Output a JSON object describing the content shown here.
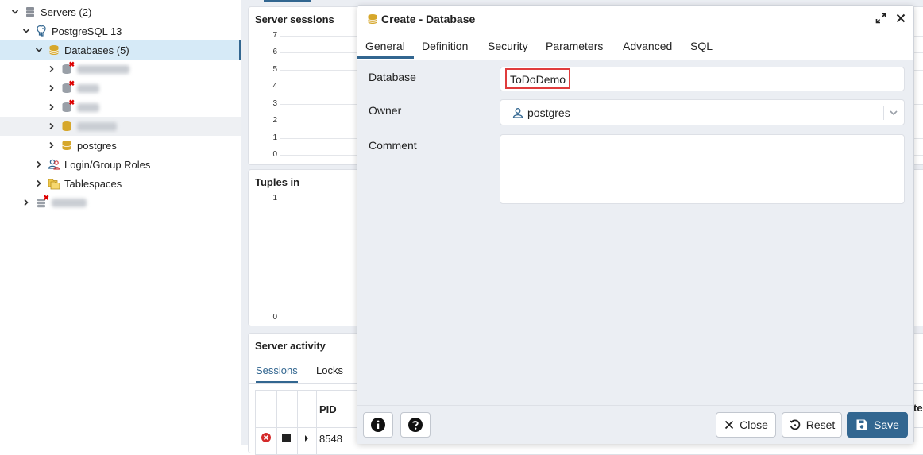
{
  "tree": {
    "servers_label": "Servers (2)",
    "pg_label": "PostgreSQL 13",
    "databases_label": "Databases (5)",
    "postgres_label": "postgres",
    "login_roles_label": "Login/Group Roles",
    "tablespaces_label": "Tablespaces"
  },
  "dashboard": {
    "server_sessions_title": "Server sessions",
    "sessions_ticks": [
      "7",
      "6",
      "5",
      "4",
      "3",
      "2",
      "1",
      "0"
    ],
    "tuples_in_title": "Tuples in",
    "tuples_ticks": [
      "1",
      "0"
    ],
    "server_activity_title": "Server activity",
    "activity_tabs": [
      "Sessions",
      "Locks"
    ],
    "table_header_pid": "PID",
    "table_row_pid": "8548",
    "table_header_cut": "te"
  },
  "dialog": {
    "title": "Create - Database",
    "tabs": [
      "General",
      "Definition",
      "Security",
      "Parameters",
      "Advanced",
      "SQL"
    ],
    "database_label": "Database",
    "database_value": "ToDoDemo",
    "owner_label": "Owner",
    "owner_value": "postgres",
    "comment_label": "Comment",
    "comment_value": "",
    "close_label": "Close",
    "reset_label": "Reset",
    "save_label": "Save"
  },
  "colors": {
    "accent": "#326690",
    "highlight_box": "#e03c3c",
    "db_icon": "#d6a72b"
  }
}
